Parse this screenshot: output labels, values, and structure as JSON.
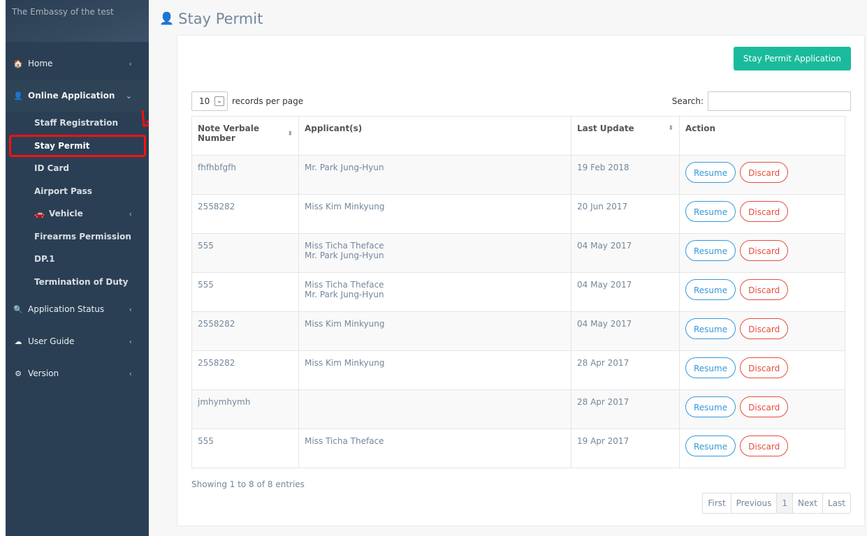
{
  "sidebar": {
    "brand": "The Embassy of the test",
    "items": [
      {
        "label": "Home",
        "icon": "home-icon",
        "glyph": "🏠"
      },
      {
        "label": "Online Application",
        "icon": "user-icon",
        "glyph": "👤"
      },
      {
        "label": "Application Status",
        "icon": "search-icon",
        "glyph": "🔍"
      },
      {
        "label": "User Guide",
        "icon": "cloud-download-icon",
        "glyph": "☁"
      },
      {
        "label": "Version",
        "icon": "cogs-icon",
        "glyph": "⚙"
      }
    ],
    "sub_items": [
      {
        "label": "Staff Registration"
      },
      {
        "label": "Stay Permit"
      },
      {
        "label": "ID Card"
      },
      {
        "label": "Airport Pass"
      },
      {
        "label": "Vehicle",
        "icon": "car-icon",
        "glyph": "🚗"
      },
      {
        "label": "Firearms Permission"
      },
      {
        "label": "DP.1"
      },
      {
        "label": "Termination of Duty"
      }
    ]
  },
  "page": {
    "title": "Stay Permit",
    "new_button": "Stay Permit Application",
    "length_value": "10",
    "length_suffix": "records per page",
    "search_label": "Search:",
    "search_value": ""
  },
  "table": {
    "headers": [
      "Note Verbale Number",
      "Applicant(s)",
      "Last Update",
      "Action"
    ],
    "resume_label": "Resume",
    "discard_label": "Discard",
    "rows": [
      {
        "nv": "fhfhbfgfh",
        "applicants": [
          "Mr. Park Jung-Hyun"
        ],
        "updated": "19 Feb 2018"
      },
      {
        "nv": "2558282",
        "applicants": [
          "Miss Kim Minkyung"
        ],
        "updated": "20 Jun 2017"
      },
      {
        "nv": "555",
        "applicants": [
          "Miss Ticha Theface",
          "Mr. Park Jung-Hyun"
        ],
        "updated": "04 May 2017"
      },
      {
        "nv": "555",
        "applicants": [
          "Miss Ticha Theface",
          "Mr. Park Jung-Hyun"
        ],
        "updated": "04 May 2017"
      },
      {
        "nv": "2558282",
        "applicants": [
          "Miss Kim Minkyung"
        ],
        "updated": "04 May 2017"
      },
      {
        "nv": "2558282",
        "applicants": [
          "Miss Kim Minkyung"
        ],
        "updated": "28 Apr 2017"
      },
      {
        "nv": "jmhymhymh",
        "applicants": [],
        "updated": "28 Apr 2017"
      },
      {
        "nv": "555",
        "applicants": [
          "Miss Ticha Theface"
        ],
        "updated": "19 Apr 2017"
      }
    ]
  },
  "footer": {
    "info": "Showing 1 to 8 of 8 entries",
    "pager": {
      "first": "First",
      "previous": "Previous",
      "current": "1",
      "next": "Next",
      "last": "Last"
    }
  },
  "colors": {
    "sidebar": "#2a3f54",
    "primary_green": "#1abb9c",
    "resume_blue": "#3498db",
    "discard_red": "#e74c3c",
    "highlight_red": "#ff1010"
  }
}
